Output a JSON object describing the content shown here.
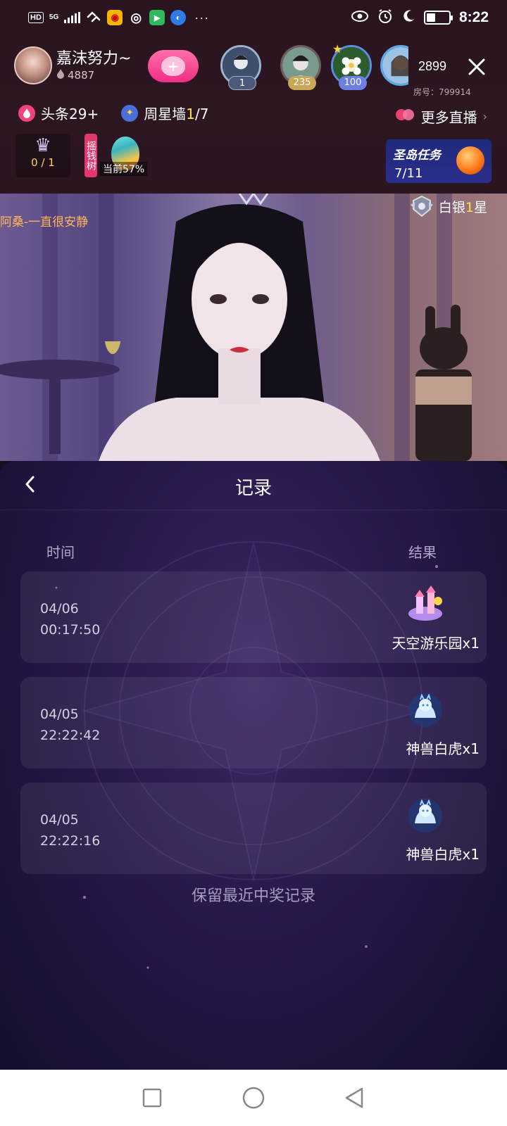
{
  "status_bar": {
    "hd": "HD",
    "network": "5G",
    "dots": "···",
    "time": "8:22"
  },
  "host": {
    "name": "嘉沫努力~",
    "score": "4887"
  },
  "viewers": [
    {
      "badge": "1",
      "color": "#8fa2c2"
    },
    {
      "badge": "235",
      "color": "#d8b46a"
    },
    {
      "badge": "100",
      "color": "#7f8de0"
    }
  ],
  "room": {
    "count": "2899",
    "id_label": "房号：799914"
  },
  "tags": {
    "headline_label": "头条29+",
    "star_wall_prefix": "周星墙",
    "star_wall_current": "1",
    "star_wall_total": "/7",
    "more_live": "更多直播"
  },
  "widgets": {
    "crown_count": "0 / 1",
    "money_tree_label": "摇钱树",
    "money_tree_progress": "当前57%",
    "task_title": "圣岛任务",
    "task_progress": "7/11"
  },
  "video": {
    "overlay_text": "阿桑-一直很安静",
    "rank_prefix": "白银",
    "rank_num": "1",
    "rank_suffix": "星"
  },
  "panel": {
    "title": "记录",
    "col_time": "时间",
    "col_result": "结果",
    "records": [
      {
        "date": "04/06",
        "time": "00:17:50",
        "prize": "天空游乐园x1",
        "icon": "sky-park-icon"
      },
      {
        "date": "04/05",
        "time": "22:22:42",
        "prize": "神兽白虎x1",
        "icon": "white-tiger-icon"
      },
      {
        "date": "04/05",
        "time": "22:22:16",
        "prize": "神兽白虎x1",
        "icon": "white-tiger-icon"
      }
    ],
    "note": "保留最近中奖记录"
  },
  "colors": {
    "accent_pink": "#f02d86",
    "highlight_yellow": "#ffe24a",
    "panel_bg": "#27184a"
  }
}
